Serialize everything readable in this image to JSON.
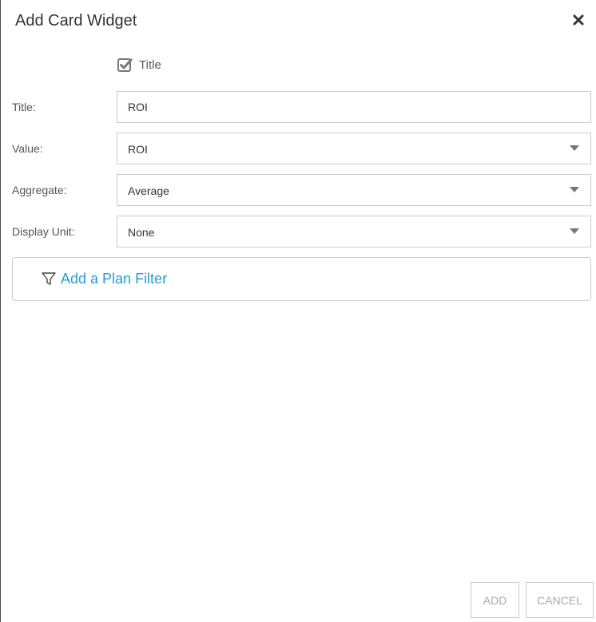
{
  "dialog": {
    "title": "Add Card Widget",
    "close_icon": "close-icon"
  },
  "title_toggle": {
    "label": "Title",
    "checked": true,
    "icon": "checkbox-checked-icon"
  },
  "form": {
    "title_field": {
      "label": "Title:",
      "value": "ROI"
    },
    "value_field": {
      "label": "Value:",
      "selected": "ROI"
    },
    "aggregate_field": {
      "label": "Aggregate:",
      "selected": "Average"
    },
    "display_unit_field": {
      "label": "Display Unit:",
      "selected": "None"
    },
    "caret_icon": "caret-down-icon"
  },
  "plan_filter": {
    "link_label": "Add a Plan Filter",
    "icon": "filter-icon"
  },
  "footer": {
    "add_label": "ADD",
    "cancel_label": "CANCEL"
  },
  "colors": {
    "link": "#2b9bd6",
    "border": "#cccccc",
    "disabled_text": "#aaaaaa",
    "title_text": "#333333"
  }
}
